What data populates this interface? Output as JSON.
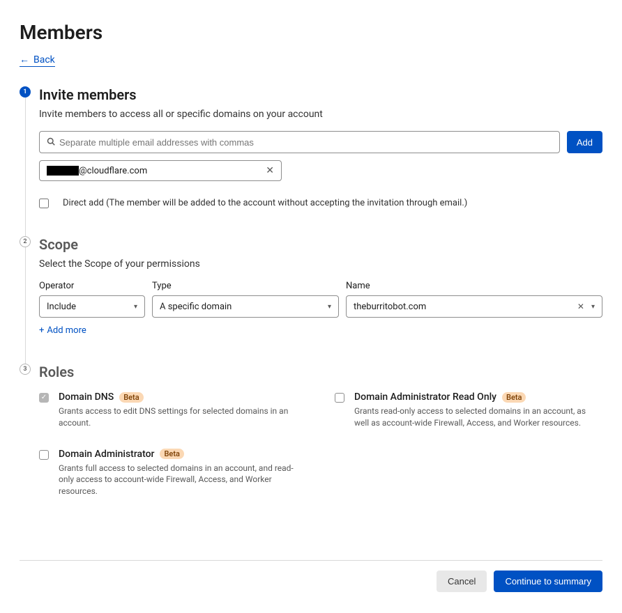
{
  "page": {
    "title": "Members",
    "back_label": "Back"
  },
  "step1": {
    "number": "1",
    "heading": "Invite members",
    "description": "Invite members to access all or specific domains on your account",
    "email_placeholder": "Separate multiple email addresses with commas",
    "add_button": "Add",
    "chip_suffix": "@cloudflare.com",
    "direct_add_label": "Direct add (The member will be added to the account without accepting the invitation through email.)"
  },
  "step2": {
    "number": "2",
    "heading": "Scope",
    "description": "Select the Scope of your permissions",
    "labels": {
      "operator": "Operator",
      "type": "Type",
      "name": "Name"
    },
    "values": {
      "operator": "Include",
      "type": "A specific domain",
      "name": "theburritobot.com"
    },
    "add_more": "Add more"
  },
  "step3": {
    "number": "3",
    "heading": "Roles",
    "beta": "Beta",
    "roles": [
      {
        "title": "Domain DNS",
        "desc": "Grants access to edit DNS settings for selected domains in an account.",
        "checked": true,
        "beta": true
      },
      {
        "title": "Domain Administrator Read Only",
        "desc": "Grants read-only access to selected domains in an account, as well as account-wide Firewall, Access, and Worker resources.",
        "checked": false,
        "beta": true
      },
      {
        "title": "Domain Administrator",
        "desc": "Grants full access to selected domains in an account, and read-only access to account-wide Firewall, Access, and Worker resources.",
        "checked": false,
        "beta": true
      }
    ]
  },
  "footer": {
    "cancel": "Cancel",
    "continue": "Continue to summary"
  }
}
